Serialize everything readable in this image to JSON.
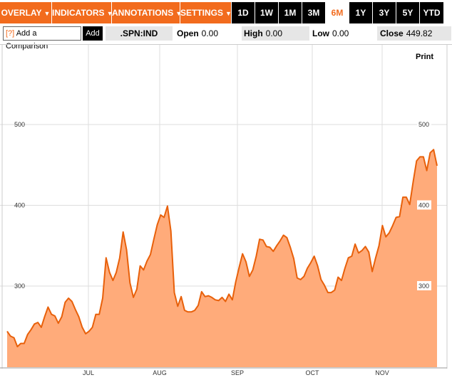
{
  "toolbar": {
    "menus": [
      {
        "label": "OVERLAY"
      },
      {
        "label": "INDICATORS"
      },
      {
        "label": "ANNOTATIONS"
      },
      {
        "label": "SETTINGS"
      }
    ],
    "ranges": [
      "1D",
      "1W",
      "1M",
      "3M",
      "6M",
      "1Y",
      "3Y",
      "5Y",
      "YTD"
    ],
    "active_range": "6M"
  },
  "infobar": {
    "compare_hint": "[?]",
    "compare_label": "Add a Comparison",
    "add_label": "Add",
    "symbol": ".SPN:IND",
    "open_label": "Open",
    "open_value": "0.00",
    "high_label": "High",
    "high_value": "0.00",
    "low_label": "Low",
    "low_value": "0.00",
    "close_label": "Close",
    "close_value": "449.82"
  },
  "print_label": "Print",
  "colors": {
    "accent": "#f26b1d",
    "line": "#e8600a",
    "fill": "#ffab7a"
  },
  "chart_data": {
    "type": "area",
    "x_months": [
      "JUL",
      "AUG",
      "SEP",
      "OCT",
      "NOV"
    ],
    "y_ticks": [
      "500",
      "400",
      "300"
    ],
    "ylim": [
      200,
      520
    ],
    "grid": true,
    "series": [
      {
        "values": [
          244,
          238,
          236,
          225,
          229,
          229,
          240,
          246,
          253,
          255,
          249,
          262,
          274,
          265,
          263,
          254,
          262,
          280,
          285,
          281,
          271,
          262,
          249,
          241,
          244,
          249,
          265,
          265,
          285,
          335,
          317,
          307,
          317,
          335,
          367,
          345,
          304,
          286,
          296,
          325,
          320,
          331,
          339,
          358,
          376,
          388,
          385,
          399,
          368,
          292,
          275,
          287,
          270,
          268,
          268,
          270,
          276,
          293,
          287,
          288,
          286,
          283,
          282,
          286,
          281,
          290,
          283,
          305,
          323,
          340,
          330,
          312,
          320,
          337,
          358,
          357,
          349,
          348,
          343,
          350,
          356,
          363,
          360,
          348,
          334,
          310,
          308,
          312,
          322,
          329,
          337,
          325,
          308,
          301,
          292,
          292,
          295,
          311,
          307,
          322,
          335,
          337,
          352,
          341,
          344,
          349,
          342,
          318,
          335,
          350,
          375,
          361,
          366,
          375,
          385,
          386,
          410,
          410,
          401,
          429,
          455,
          460,
          460,
          443,
          465,
          469,
          449
        ]
      }
    ]
  }
}
